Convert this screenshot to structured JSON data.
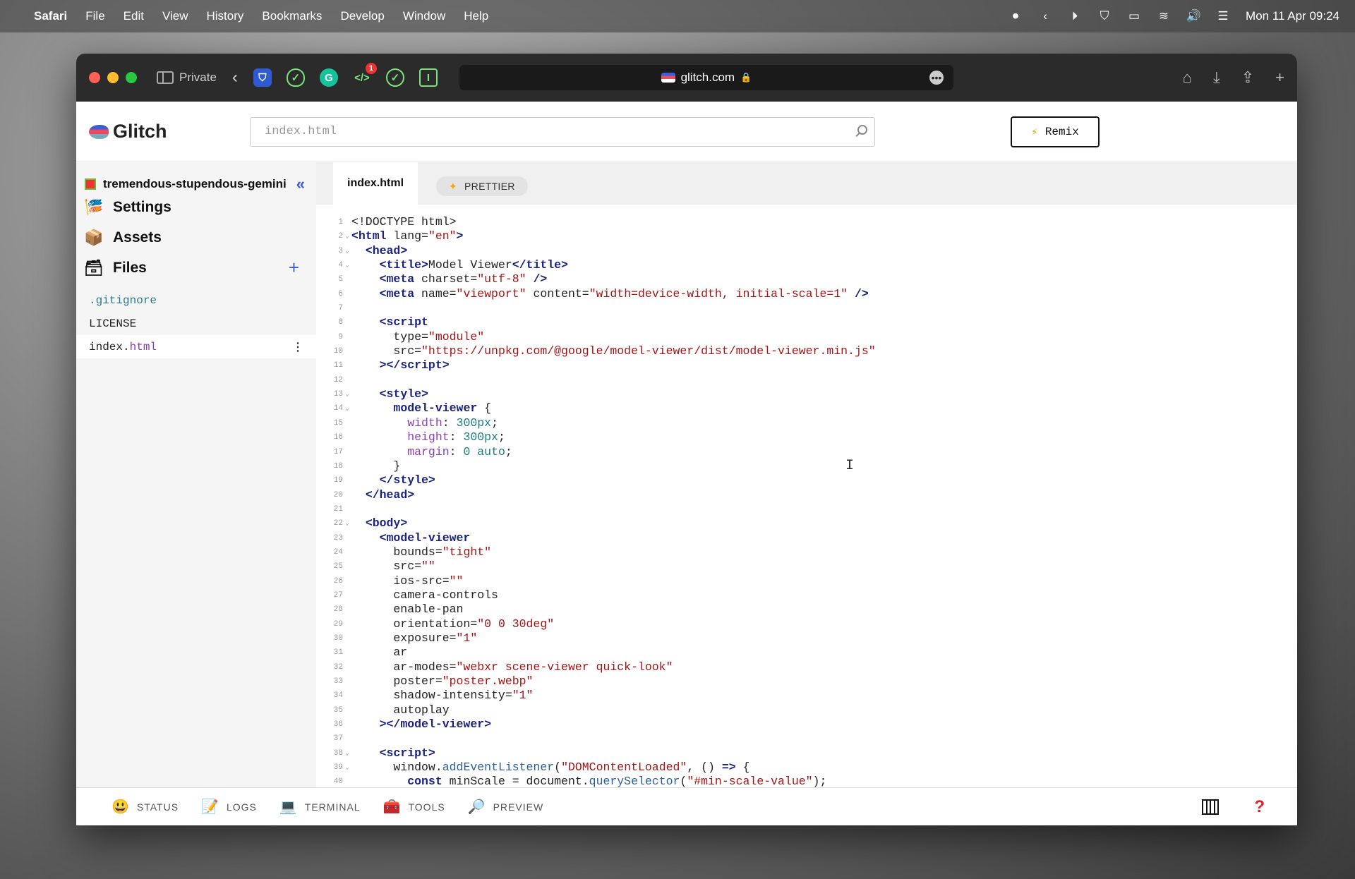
{
  "menubar": {
    "apple": "",
    "app": "Safari",
    "items": [
      "File",
      "Edit",
      "View",
      "History",
      "Bookmarks",
      "Develop",
      "Window",
      "Help"
    ],
    "clock": "Mon 11 Apr  09:24"
  },
  "browser": {
    "private_label": "Private",
    "ext_badge": "1",
    "url": "glitch.com",
    "lock": "🔒"
  },
  "glitch": {
    "logo": "Glitch",
    "search_placeholder": "index.html",
    "remix_label": "Remix",
    "project_name": "tremendous-stupendous-gemini",
    "nav": {
      "settings": "Settings",
      "assets": "Assets",
      "files": "Files"
    },
    "files": [
      {
        "name": ".gitignore"
      },
      {
        "name": "LICENSE"
      },
      {
        "base": "index.",
        "ext": "html"
      }
    ],
    "tab": "index.html",
    "prettier": "PRETTIER"
  },
  "code_lines": [
    "<span class=\"kw\"></span>&lt;!DOCTYPE html&gt;",
    "<span class=\"tag\">&lt;html</span> lang=<span class=\"str\">\"en\"</span><span class=\"tag\">&gt;</span>",
    "  <span class=\"tag\">&lt;head&gt;</span>",
    "    <span class=\"tag\">&lt;title&gt;</span>Model Viewer<span class=\"tag\">&lt;/title&gt;</span>",
    "    <span class=\"tag\">&lt;meta</span> charset=<span class=\"str\">\"utf-8\"</span> <span class=\"tag\">/&gt;</span>",
    "    <span class=\"tag\">&lt;meta</span> name=<span class=\"str\">\"viewport\"</span> content=<span class=\"str\">\"width=device-width, initial-scale=1\"</span> <span class=\"tag\">/&gt;</span>",
    "",
    "    <span class=\"tag\">&lt;script</span>",
    "      type=<span class=\"str\">\"module\"</span>",
    "      src=<span class=\"str\">\"https://unpkg.com/@google/model-viewer/dist/model-viewer.min.js\"</span>",
    "    <span class=\"tag\">&gt;&lt;/script&gt;</span>",
    "",
    "    <span class=\"tag\">&lt;style&gt;</span>",
    "      <span class=\"tag\">model-viewer</span> {",
    "        <span class=\"prop\">width</span>: <span class=\"num\">300px</span>;",
    "        <span class=\"prop\">height</span>: <span class=\"num\">300px</span>;",
    "        <span class=\"prop\">margin</span>: <span class=\"num\">0</span> <span class=\"num\">auto</span>;",
    "      }",
    "    <span class=\"tag\">&lt;/style&gt;</span>",
    "  <span class=\"tag\">&lt;/head&gt;</span>",
    "",
    "  <span class=\"tag\">&lt;body&gt;</span>",
    "    <span class=\"tag\">&lt;model-viewer</span>",
    "      bounds=<span class=\"str\">\"tight\"</span>",
    "      src=<span class=\"str\">\"\"</span>",
    "      ios-src=<span class=\"str\">\"\"</span>",
    "      camera-controls",
    "      enable-pan",
    "      orientation=<span class=\"str\">\"0 0 30deg\"</span>",
    "      exposure=<span class=\"str\">\"1\"</span>",
    "      ar",
    "      ar-modes=<span class=\"str\">\"webxr scene-viewer quick-look\"</span>",
    "      poster=<span class=\"str\">\"poster.webp\"</span>",
    "      shadow-intensity=<span class=\"str\">\"1\"</span>",
    "      autoplay",
    "    <span class=\"tag\">&gt;&lt;/model-viewer&gt;</span>",
    "",
    "    <span class=\"tag\">&lt;script&gt;</span>",
    "      window.<span class=\"fn\">addEventListener</span>(<span class=\"str\">\"DOMContentLoaded\"</span>, () <span class=\"kw\">=&gt;</span> {",
    "        <span class=\"kw\">const</span> minScale = document.<span class=\"fn\">querySelector</span>(<span class=\"str\">\"#min-scale-value\"</span>);"
  ],
  "fold_lines": [
    2,
    3,
    4,
    13,
    14,
    22,
    38,
    39
  ],
  "footer": {
    "status": "STATUS",
    "logs": "LOGS",
    "terminal": "TERMINAL",
    "tools": "TOOLS",
    "preview": "PREVIEW",
    "help": "?"
  }
}
